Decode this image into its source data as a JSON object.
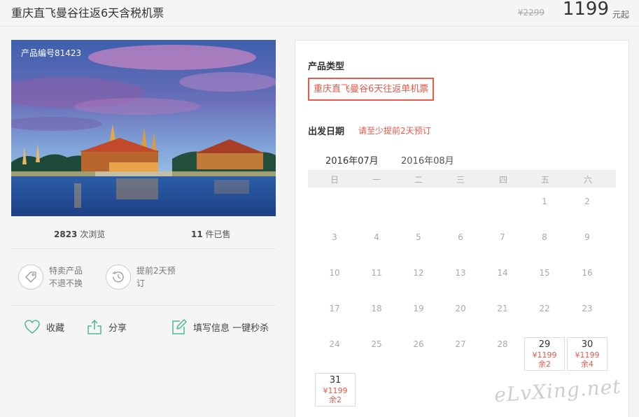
{
  "header": {
    "title": "重庆直飞曼谷往返6天含税机票",
    "old_price": "¥2299",
    "price": "1199",
    "price_suffix": "元起"
  },
  "product": {
    "code_label": "产品编号81423",
    "views_count": "2823",
    "views_label": "次浏览",
    "sold_count": "11",
    "sold_label": "件已售"
  },
  "features": [
    {
      "icon": "tag-icon",
      "line1": "特卖产品",
      "line2": "不退不换"
    },
    {
      "icon": "clock-icon",
      "line1": "提前2天预",
      "line2": "订"
    }
  ],
  "actions": {
    "favorite": "收藏",
    "share": "分享",
    "fill_info": "填写信息 一键秒杀"
  },
  "booking": {
    "type_label": "产品类型",
    "type_option": "重庆直飞曼谷6天往返单机票",
    "date_label": "出发日期",
    "date_hint": "请至少提前2天预订",
    "months": [
      "2016年07月",
      "2016年08月"
    ],
    "weekdays": [
      "日",
      "一",
      "二",
      "三",
      "四",
      "五",
      "六"
    ],
    "days": [
      "1",
      "2",
      "3",
      "4",
      "5",
      "6",
      "7",
      "8",
      "9",
      "10",
      "11",
      "12",
      "13",
      "14",
      "15",
      "16",
      "17",
      "18",
      "19",
      "20",
      "21",
      "22",
      "23",
      "24",
      "25",
      "26",
      "27",
      "28"
    ],
    "available": [
      {
        "day": "29",
        "price": "¥1199",
        "remain": "余2"
      },
      {
        "day": "30",
        "price": "¥1199",
        "remain": "余4"
      },
      {
        "day": "31",
        "price": "¥1199",
        "remain": "余2"
      }
    ]
  },
  "watermark": "eLvXing.net",
  "colors": {
    "accent": "#e8594a",
    "icon_green": "#4cb894"
  }
}
